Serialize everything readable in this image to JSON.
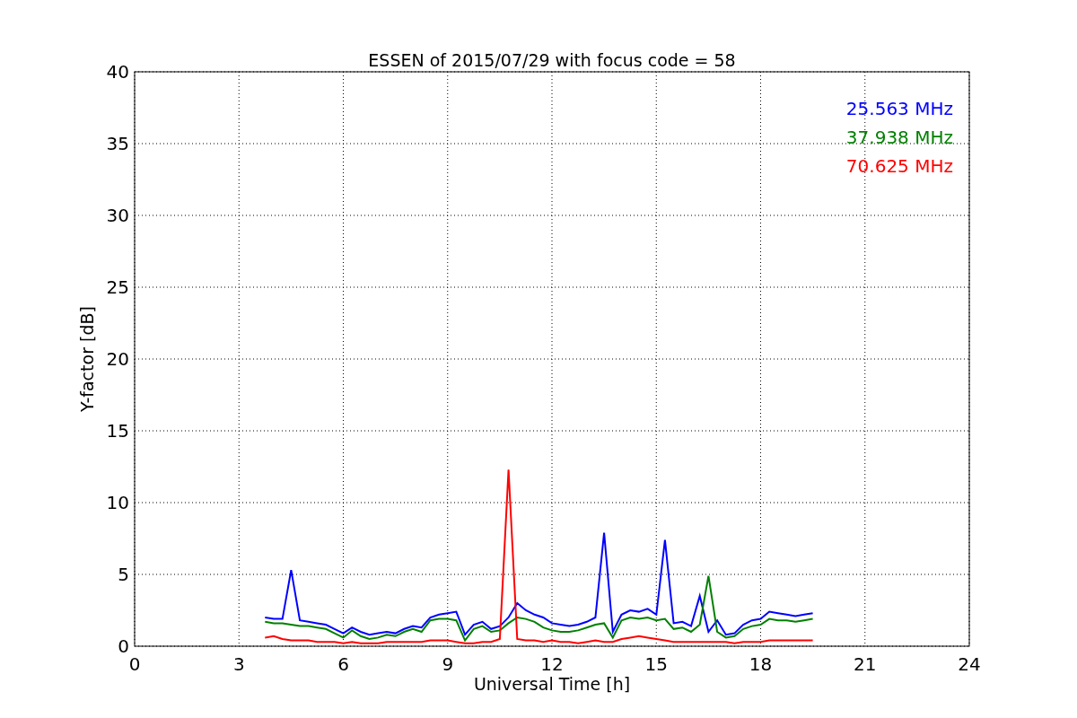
{
  "chart_data": {
    "type": "line",
    "title": "ESSEN of 2015/07/29 with focus code = 58",
    "xlabel": "Universal Time [h]",
    "ylabel": "Y-factor [dB]",
    "x": [
      3.75,
      4,
      4.25,
      4.5,
      4.75,
      5,
      5.25,
      5.5,
      5.75,
      6,
      6.25,
      6.5,
      6.75,
      7,
      7.25,
      7.5,
      7.75,
      8,
      8.25,
      8.5,
      8.75,
      9,
      9.25,
      9.5,
      9.75,
      10,
      10.25,
      10.5,
      10.75,
      11,
      11.25,
      11.5,
      11.75,
      12,
      12.25,
      12.5,
      12.75,
      13,
      13.25,
      13.5,
      13.75,
      14,
      14.25,
      14.5,
      14.75,
      15,
      15.25,
      15.5,
      15.75,
      16,
      16.25,
      16.5,
      16.75,
      17,
      17.25,
      17.5,
      17.75,
      18,
      18.25,
      18.5,
      18.75,
      19,
      19.25,
      19.5
    ],
    "series": [
      {
        "name": "25.563 MHz",
        "color": "#0000ff",
        "values": [
          2.0,
          1.9,
          1.9,
          5.3,
          1.8,
          1.7,
          1.6,
          1.5,
          1.2,
          0.9,
          1.3,
          1.0,
          0.8,
          0.9,
          1.0,
          0.9,
          1.2,
          1.4,
          1.3,
          2.0,
          2.2,
          2.3,
          2.4,
          0.8,
          1.5,
          1.7,
          1.2,
          1.4,
          2.0,
          3.0,
          2.5,
          2.2,
          2.0,
          1.6,
          1.5,
          1.4,
          1.5,
          1.7,
          2.0,
          7.9,
          1.0,
          2.2,
          2.5,
          2.4,
          2.6,
          2.2,
          7.4,
          1.6,
          1.7,
          1.4,
          3.5,
          1.0,
          1.8,
          0.8,
          0.9,
          1.5,
          1.8,
          1.9,
          2.4,
          2.3,
          2.2,
          2.1,
          2.2,
          2.3
        ]
      },
      {
        "name": "37.938 MHz",
        "color": "#008000",
        "values": [
          1.7,
          1.6,
          1.6,
          1.5,
          1.4,
          1.4,
          1.3,
          1.2,
          0.9,
          0.6,
          1.1,
          0.7,
          0.5,
          0.6,
          0.8,
          0.7,
          1.0,
          1.2,
          1.0,
          1.8,
          1.9,
          1.9,
          1.8,
          0.4,
          1.2,
          1.4,
          1.0,
          1.1,
          1.6,
          2.0,
          1.9,
          1.7,
          1.3,
          1.1,
          1.0,
          1.0,
          1.1,
          1.3,
          1.5,
          1.6,
          0.6,
          1.8,
          2.0,
          1.9,
          2.0,
          1.8,
          1.9,
          1.2,
          1.3,
          1.0,
          1.5,
          4.9,
          1.0,
          0.6,
          0.7,
          1.2,
          1.4,
          1.5,
          1.9,
          1.8,
          1.8,
          1.7,
          1.8,
          1.9
        ]
      },
      {
        "name": "70.625 MHz",
        "color": "#ff0000",
        "values": [
          0.6,
          0.7,
          0.5,
          0.4,
          0.4,
          0.4,
          0.3,
          0.3,
          0.3,
          0.2,
          0.3,
          0.2,
          0.2,
          0.2,
          0.3,
          0.3,
          0.3,
          0.3,
          0.3,
          0.4,
          0.4,
          0.4,
          0.3,
          0.2,
          0.2,
          0.3,
          0.3,
          0.5,
          12.3,
          0.5,
          0.4,
          0.4,
          0.3,
          0.4,
          0.3,
          0.3,
          0.2,
          0.3,
          0.4,
          0.3,
          0.3,
          0.5,
          0.6,
          0.7,
          0.6,
          0.5,
          0.4,
          0.3,
          0.3,
          0.3,
          0.3,
          0.3,
          0.3,
          0.3,
          0.2,
          0.3,
          0.3,
          0.3,
          0.4,
          0.4,
          0.4,
          0.4,
          0.4,
          0.4
        ]
      }
    ],
    "grid": true,
    "xlim": [
      0,
      24
    ],
    "ylim": [
      0,
      40
    ],
    "xticks": [
      0,
      3,
      6,
      9,
      12,
      15,
      18,
      21,
      24
    ],
    "yticks": [
      0,
      5,
      10,
      15,
      20,
      25,
      30,
      35,
      40
    ]
  }
}
